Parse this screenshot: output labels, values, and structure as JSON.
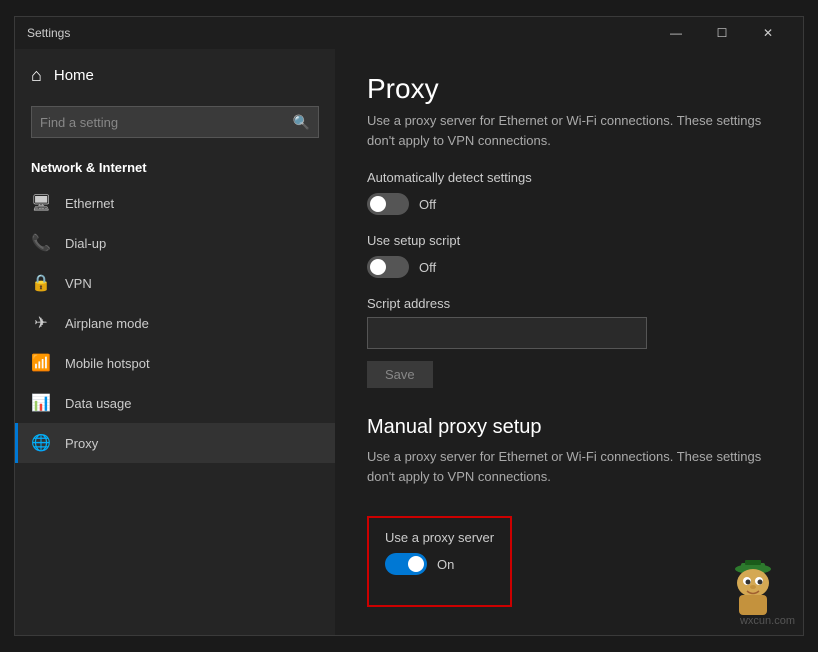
{
  "window": {
    "title": "Settings",
    "controls": {
      "minimize": "—",
      "maximize": "☐",
      "close": "✕"
    }
  },
  "sidebar": {
    "home_label": "Home",
    "search_placeholder": "Find a setting",
    "section_title": "Network & Internet",
    "nav_items": [
      {
        "id": "ethernet",
        "label": "Ethernet",
        "icon": "🖥"
      },
      {
        "id": "dialup",
        "label": "Dial-up",
        "icon": "📞"
      },
      {
        "id": "vpn",
        "label": "VPN",
        "icon": "🔒"
      },
      {
        "id": "airplane",
        "label": "Airplane mode",
        "icon": "✈"
      },
      {
        "id": "hotspot",
        "label": "Mobile hotspot",
        "icon": "📶"
      },
      {
        "id": "datausage",
        "label": "Data usage",
        "icon": "📊"
      },
      {
        "id": "proxy",
        "label": "Proxy",
        "icon": "🌐",
        "active": true
      }
    ]
  },
  "main": {
    "page_title": "Proxy",
    "auto_proxy_description": "Use a proxy server for Ethernet or Wi-Fi connections. These settings don't apply to VPN connections.",
    "auto_detect_label": "Automatically detect settings",
    "auto_detect_state": "Off",
    "setup_script_label": "Use setup script",
    "setup_script_state": "Off",
    "script_address_label": "Script address",
    "script_address_value": "",
    "save_button_label": "Save",
    "manual_section_title": "Manual proxy setup",
    "manual_description": "Use a proxy server for Ethernet or Wi-Fi connections. These settings don't apply to VPN connections.",
    "proxy_server_label": "Use a proxy server",
    "proxy_server_state": "On",
    "watermark": "wxcun.com"
  }
}
